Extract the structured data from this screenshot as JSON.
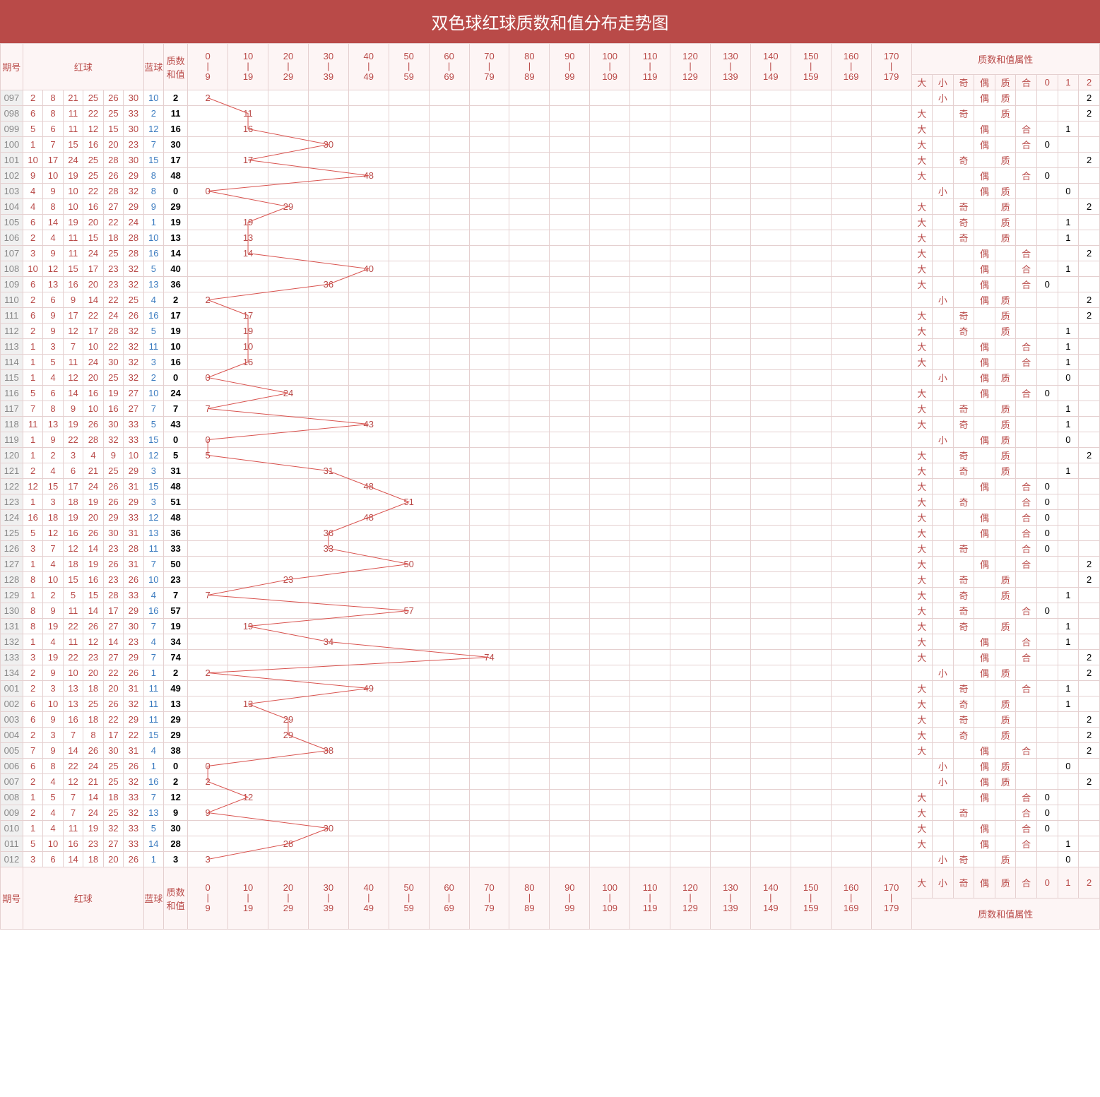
{
  "title": "双色球红球质数和值分布走势图",
  "headers": {
    "period": "期号",
    "red_ball": "红球",
    "blue_ball": "蓝球",
    "prime_sum": "质数和值",
    "attr_group": "质数和值属性",
    "ranges": [
      {
        "label": "0|9",
        "lo": 0,
        "hi": 9
      },
      {
        "label": "10|19",
        "lo": 10,
        "hi": 19
      },
      {
        "label": "20|29",
        "lo": 20,
        "hi": 29
      },
      {
        "label": "30|39",
        "lo": 30,
        "hi": 39
      },
      {
        "label": "40|49",
        "lo": 40,
        "hi": 49
      },
      {
        "label": "50|59",
        "lo": 50,
        "hi": 59
      },
      {
        "label": "60|69",
        "lo": 60,
        "hi": 69
      },
      {
        "label": "70|79",
        "lo": 70,
        "hi": 79
      },
      {
        "label": "80|89",
        "lo": 80,
        "hi": 89
      },
      {
        "label": "90|99",
        "lo": 90,
        "hi": 99
      },
      {
        "label": "100|109",
        "lo": 100,
        "hi": 109
      },
      {
        "label": "110|119",
        "lo": 110,
        "hi": 119
      },
      {
        "label": "120|129",
        "lo": 120,
        "hi": 129
      },
      {
        "label": "130|139",
        "lo": 130,
        "hi": 139
      },
      {
        "label": "140|149",
        "lo": 140,
        "hi": 149
      },
      {
        "label": "150|159",
        "lo": 150,
        "hi": 159
      },
      {
        "label": "160|169",
        "lo": 160,
        "hi": 169
      },
      {
        "label": "170|179",
        "lo": 170,
        "hi": 179
      }
    ],
    "attrs": [
      "大",
      "小",
      "奇",
      "偶",
      "质",
      "合",
      "0",
      "1",
      "2"
    ]
  },
  "chart_data": {
    "type": "line",
    "title": "双色球红球质数和值分布走势图",
    "xlabel": "期号",
    "ylabel": "质数和值",
    "series": [
      {
        "name": "质数和值",
        "values": [
          2,
          11,
          16,
          30,
          17,
          48,
          0,
          29,
          19,
          13,
          14,
          40,
          36,
          2,
          17,
          19,
          10,
          16,
          0,
          24,
          7,
          43,
          0,
          5,
          31,
          48,
          51,
          48,
          36,
          33,
          50,
          23,
          7,
          57,
          19,
          34,
          74,
          2,
          49,
          13,
          29,
          29,
          38,
          0,
          2,
          12,
          9,
          30,
          28,
          3
        ]
      }
    ],
    "categories": [
      "097",
      "098",
      "099",
      "100",
      "101",
      "102",
      "103",
      "104",
      "105",
      "106",
      "107",
      "108",
      "109",
      "110",
      "111",
      "112",
      "113",
      "114",
      "115",
      "116",
      "117",
      "118",
      "119",
      "120",
      "121",
      "122",
      "123",
      "124",
      "125",
      "126",
      "127",
      "128",
      "129",
      "130",
      "131",
      "132",
      "133",
      "134",
      "001",
      "002",
      "003",
      "004",
      "005",
      "006",
      "007",
      "008",
      "009",
      "010",
      "011",
      "012"
    ],
    "ylim": [
      0,
      179
    ]
  },
  "rows": [
    {
      "p": "097",
      "r": [
        2,
        8,
        21,
        25,
        26,
        30
      ],
      "b": 10,
      "s": 2,
      "a": [
        "",
        "小",
        "",
        "偶",
        "质",
        "",
        "",
        "",
        "2"
      ]
    },
    {
      "p": "098",
      "r": [
        6,
        8,
        11,
        22,
        25,
        33
      ],
      "b": 2,
      "s": 11,
      "a": [
        "大",
        "",
        "奇",
        "",
        "质",
        "",
        "",
        "",
        "2"
      ]
    },
    {
      "p": "099",
      "r": [
        5,
        6,
        11,
        12,
        15,
        30
      ],
      "b": 12,
      "s": 16,
      "a": [
        "大",
        "",
        "",
        "偶",
        "",
        "合",
        "",
        "1",
        ""
      ]
    },
    {
      "p": "100",
      "r": [
        1,
        7,
        15,
        16,
        20,
        23
      ],
      "b": 7,
      "s": 30,
      "a": [
        "大",
        "",
        "",
        "偶",
        "",
        "合",
        "0",
        "",
        ""
      ]
    },
    {
      "p": "101",
      "r": [
        10,
        17,
        24,
        25,
        28,
        30
      ],
      "b": 15,
      "s": 17,
      "a": [
        "大",
        "",
        "奇",
        "",
        "质",
        "",
        "",
        "",
        "2"
      ]
    },
    {
      "p": "102",
      "r": [
        9,
        10,
        19,
        25,
        26,
        29
      ],
      "b": 8,
      "s": 48,
      "a": [
        "大",
        "",
        "",
        "偶",
        "",
        "合",
        "0",
        "",
        ""
      ]
    },
    {
      "p": "103",
      "r": [
        4,
        9,
        10,
        22,
        28,
        32
      ],
      "b": 8,
      "s": 0,
      "a": [
        "",
        "小",
        "",
        "偶",
        "质",
        "",
        "",
        "0",
        ""
      ]
    },
    {
      "p": "104",
      "r": [
        4,
        8,
        10,
        16,
        27,
        29
      ],
      "b": 9,
      "s": 29,
      "a": [
        "大",
        "",
        "奇",
        "",
        "质",
        "",
        "",
        "",
        "2"
      ]
    },
    {
      "p": "105",
      "r": [
        6,
        14,
        19,
        20,
        22,
        24
      ],
      "b": 1,
      "s": 19,
      "a": [
        "大",
        "",
        "奇",
        "",
        "质",
        "",
        "",
        "1",
        ""
      ]
    },
    {
      "p": "106",
      "r": [
        2,
        4,
        11,
        15,
        18,
        28
      ],
      "b": 10,
      "s": 13,
      "a": [
        "大",
        "",
        "奇",
        "",
        "质",
        "",
        "",
        "1",
        ""
      ]
    },
    {
      "p": "107",
      "r": [
        3,
        9,
        11,
        24,
        25,
        28
      ],
      "b": 16,
      "s": 14,
      "a": [
        "大",
        "",
        "",
        "偶",
        "",
        "合",
        "",
        "",
        "2"
      ]
    },
    {
      "p": "108",
      "r": [
        10,
        12,
        15,
        17,
        23,
        32
      ],
      "b": 5,
      "s": 40,
      "a": [
        "大",
        "",
        "",
        "偶",
        "",
        "合",
        "",
        "1",
        ""
      ]
    },
    {
      "p": "109",
      "r": [
        6,
        13,
        16,
        20,
        23,
        32
      ],
      "b": 13,
      "s": 36,
      "a": [
        "大",
        "",
        "",
        "偶",
        "",
        "合",
        "0",
        "",
        ""
      ]
    },
    {
      "p": "110",
      "r": [
        2,
        6,
        9,
        14,
        22,
        25
      ],
      "b": 4,
      "s": 2,
      "a": [
        "",
        "小",
        "",
        "偶",
        "质",
        "",
        "",
        "",
        "2"
      ]
    },
    {
      "p": "111",
      "r": [
        6,
        9,
        17,
        22,
        24,
        26
      ],
      "b": 16,
      "s": 17,
      "a": [
        "大",
        "",
        "奇",
        "",
        "质",
        "",
        "",
        "",
        "2"
      ]
    },
    {
      "p": "112",
      "r": [
        2,
        9,
        12,
        17,
        28,
        32
      ],
      "b": 5,
      "s": 19,
      "a": [
        "大",
        "",
        "奇",
        "",
        "质",
        "",
        "",
        "1",
        ""
      ]
    },
    {
      "p": "113",
      "r": [
        1,
        3,
        7,
        10,
        22,
        32
      ],
      "b": 11,
      "s": 10,
      "a": [
        "大",
        "",
        "",
        "偶",
        "",
        "合",
        "",
        "1",
        ""
      ]
    },
    {
      "p": "114",
      "r": [
        1,
        5,
        11,
        24,
        30,
        32
      ],
      "b": 3,
      "s": 16,
      "a": [
        "大",
        "",
        "",
        "偶",
        "",
        "合",
        "",
        "1",
        ""
      ]
    },
    {
      "p": "115",
      "r": [
        1,
        4,
        12,
        20,
        25,
        32
      ],
      "b": 2,
      "s": 0,
      "a": [
        "",
        "小",
        "",
        "偶",
        "质",
        "",
        "",
        "0",
        ""
      ]
    },
    {
      "p": "116",
      "r": [
        5,
        6,
        14,
        16,
        19,
        27
      ],
      "b": 10,
      "s": 24,
      "a": [
        "大",
        "",
        "",
        "偶",
        "",
        "合",
        "0",
        "",
        ""
      ]
    },
    {
      "p": "117",
      "r": [
        7,
        8,
        9,
        10,
        16,
        27
      ],
      "b": 7,
      "s": 7,
      "a": [
        "大",
        "",
        "奇",
        "",
        "质",
        "",
        "",
        "1",
        ""
      ]
    },
    {
      "p": "118",
      "r": [
        11,
        13,
        19,
        26,
        30,
        33
      ],
      "b": 5,
      "s": 43,
      "a": [
        "大",
        "",
        "奇",
        "",
        "质",
        "",
        "",
        "1",
        ""
      ]
    },
    {
      "p": "119",
      "r": [
        1,
        9,
        22,
        28,
        32,
        33
      ],
      "b": 15,
      "s": 0,
      "a": [
        "",
        "小",
        "",
        "偶",
        "质",
        "",
        "",
        "0",
        ""
      ]
    },
    {
      "p": "120",
      "r": [
        1,
        2,
        3,
        4,
        9,
        10
      ],
      "b": 12,
      "s": 5,
      "a": [
        "大",
        "",
        "奇",
        "",
        "质",
        "",
        "",
        "",
        "2"
      ]
    },
    {
      "p": "121",
      "r": [
        2,
        4,
        6,
        21,
        25,
        29
      ],
      "b": 3,
      "s": 31,
      "a": [
        "大",
        "",
        "奇",
        "",
        "质",
        "",
        "",
        "1",
        ""
      ]
    },
    {
      "p": "122",
      "r": [
        12,
        15,
        17,
        24,
        26,
        31
      ],
      "b": 15,
      "s": 48,
      "a": [
        "大",
        "",
        "",
        "偶",
        "",
        "合",
        "0",
        "",
        ""
      ]
    },
    {
      "p": "123",
      "r": [
        1,
        3,
        18,
        19,
        26,
        29
      ],
      "b": 3,
      "s": 51,
      "a": [
        "大",
        "",
        "奇",
        "",
        "",
        "合",
        "0",
        "",
        ""
      ]
    },
    {
      "p": "124",
      "r": [
        16,
        18,
        19,
        20,
        29,
        33
      ],
      "b": 12,
      "s": 48,
      "a": [
        "大",
        "",
        "",
        "偶",
        "",
        "合",
        "0",
        "",
        ""
      ]
    },
    {
      "p": "125",
      "r": [
        5,
        12,
        16,
        26,
        30,
        31
      ],
      "b": 13,
      "s": 36,
      "a": [
        "大",
        "",
        "",
        "偶",
        "",
        "合",
        "0",
        "",
        ""
      ]
    },
    {
      "p": "126",
      "r": [
        3,
        7,
        12,
        14,
        23,
        28
      ],
      "b": 11,
      "s": 33,
      "a": [
        "大",
        "",
        "奇",
        "",
        "",
        "合",
        "0",
        "",
        ""
      ]
    },
    {
      "p": "127",
      "r": [
        1,
        4,
        18,
        19,
        26,
        31
      ],
      "b": 7,
      "s": 50,
      "a": [
        "大",
        "",
        "",
        "偶",
        "",
        "合",
        "",
        "",
        "2"
      ]
    },
    {
      "p": "128",
      "r": [
        8,
        10,
        15,
        16,
        23,
        26
      ],
      "b": 10,
      "s": 23,
      "a": [
        "大",
        "",
        "奇",
        "",
        "质",
        "",
        "",
        "",
        "2"
      ]
    },
    {
      "p": "129",
      "r": [
        1,
        2,
        5,
        15,
        28,
        33
      ],
      "b": 4,
      "s": 7,
      "a": [
        "大",
        "",
        "奇",
        "",
        "质",
        "",
        "",
        "1",
        ""
      ]
    },
    {
      "p": "130",
      "r": [
        8,
        9,
        11,
        14,
        17,
        29
      ],
      "b": 16,
      "s": 57,
      "a": [
        "大",
        "",
        "奇",
        "",
        "",
        "合",
        "0",
        "",
        ""
      ]
    },
    {
      "p": "131",
      "r": [
        8,
        19,
        22,
        26,
        27,
        30
      ],
      "b": 7,
      "s": 19,
      "a": [
        "大",
        "",
        "奇",
        "",
        "质",
        "",
        "",
        "1",
        ""
      ]
    },
    {
      "p": "132",
      "r": [
        1,
        4,
        11,
        12,
        14,
        23
      ],
      "b": 4,
      "s": 34,
      "a": [
        "大",
        "",
        "",
        "偶",
        "",
        "合",
        "",
        "1",
        ""
      ]
    },
    {
      "p": "133",
      "r": [
        3,
        19,
        22,
        23,
        27,
        29
      ],
      "b": 7,
      "s": 74,
      "a": [
        "大",
        "",
        "",
        "偶",
        "",
        "合",
        "",
        "",
        "2"
      ]
    },
    {
      "p": "134",
      "r": [
        2,
        9,
        10,
        20,
        22,
        26
      ],
      "b": 1,
      "s": 2,
      "a": [
        "",
        "小",
        "",
        "偶",
        "质",
        "",
        "",
        "",
        "2"
      ]
    },
    {
      "p": "001",
      "r": [
        2,
        3,
        13,
        18,
        20,
        31
      ],
      "b": 11,
      "s": 49,
      "a": [
        "大",
        "",
        "奇",
        "",
        "",
        "合",
        "",
        "1",
        ""
      ]
    },
    {
      "p": "002",
      "r": [
        6,
        10,
        13,
        25,
        26,
        32
      ],
      "b": 11,
      "s": 13,
      "a": [
        "大",
        "",
        "奇",
        "",
        "质",
        "",
        "",
        "1",
        ""
      ]
    },
    {
      "p": "003",
      "r": [
        6,
        9,
        16,
        18,
        22,
        29
      ],
      "b": 11,
      "s": 29,
      "a": [
        "大",
        "",
        "奇",
        "",
        "质",
        "",
        "",
        "",
        "2"
      ]
    },
    {
      "p": "004",
      "r": [
        2,
        3,
        7,
        8,
        17,
        22
      ],
      "b": 15,
      "s": 29,
      "a": [
        "大",
        "",
        "奇",
        "",
        "质",
        "",
        "",
        "",
        "2"
      ]
    },
    {
      "p": "005",
      "r": [
        7,
        9,
        14,
        26,
        30,
        31
      ],
      "b": 4,
      "s": 38,
      "a": [
        "大",
        "",
        "",
        "偶",
        "",
        "合",
        "",
        "",
        "2"
      ]
    },
    {
      "p": "006",
      "r": [
        6,
        8,
        22,
        24,
        25,
        26
      ],
      "b": 1,
      "s": 0,
      "a": [
        "",
        "小",
        "",
        "偶",
        "质",
        "",
        "",
        "0",
        ""
      ]
    },
    {
      "p": "007",
      "r": [
        2,
        4,
        12,
        21,
        25,
        32
      ],
      "b": 16,
      "s": 2,
      "a": [
        "",
        "小",
        "",
        "偶",
        "质",
        "",
        "",
        "",
        "2"
      ]
    },
    {
      "p": "008",
      "r": [
        1,
        5,
        7,
        14,
        18,
        33
      ],
      "b": 7,
      "s": 12,
      "a": [
        "大",
        "",
        "",
        "偶",
        "",
        "合",
        "0",
        "",
        ""
      ]
    },
    {
      "p": "009",
      "r": [
        2,
        4,
        7,
        24,
        25,
        32
      ],
      "b": 13,
      "s": 9,
      "a": [
        "大",
        "",
        "奇",
        "",
        "",
        "合",
        "0",
        "",
        ""
      ]
    },
    {
      "p": "010",
      "r": [
        1,
        4,
        11,
        19,
        32,
        33
      ],
      "b": 5,
      "s": 30,
      "a": [
        "大",
        "",
        "",
        "偶",
        "",
        "合",
        "0",
        "",
        ""
      ]
    },
    {
      "p": "011",
      "r": [
        5,
        10,
        16,
        23,
        27,
        33
      ],
      "b": 14,
      "s": 28,
      "a": [
        "大",
        "",
        "",
        "偶",
        "",
        "合",
        "",
        "1",
        ""
      ]
    },
    {
      "p": "012",
      "r": [
        3,
        6,
        14,
        18,
        20,
        26
      ],
      "b": 1,
      "s": 3,
      "a": [
        "",
        "小",
        "奇",
        "",
        "质",
        "",
        "",
        "0",
        ""
      ]
    }
  ]
}
